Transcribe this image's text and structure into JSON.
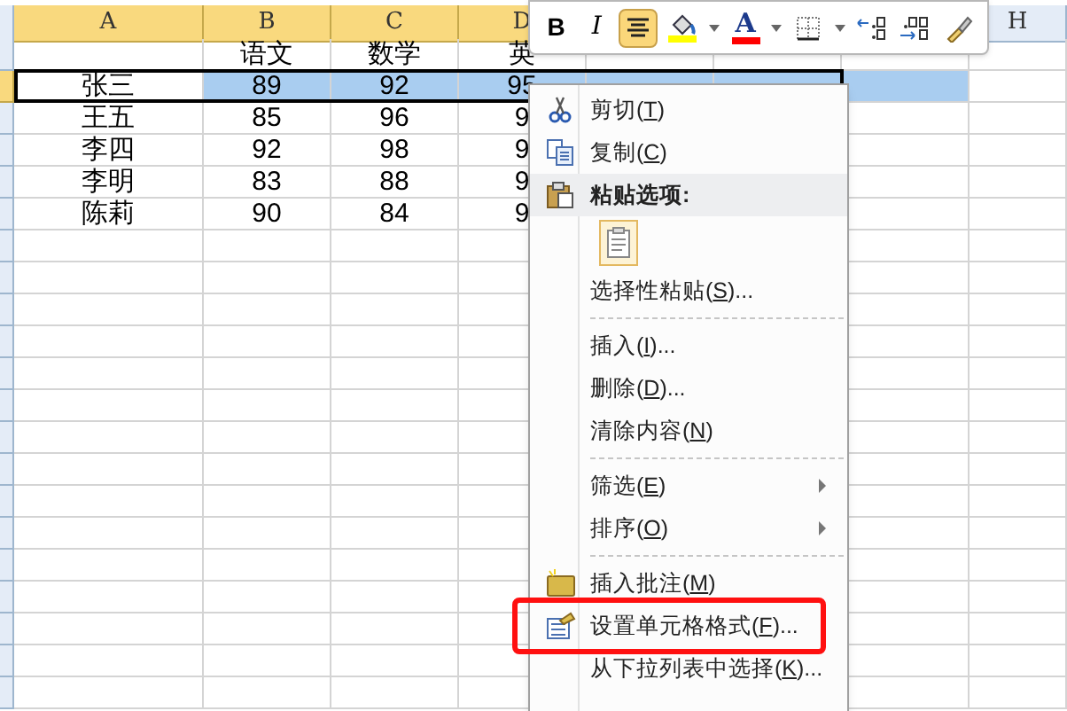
{
  "columns": [
    {
      "label": "A",
      "selected": true
    },
    {
      "label": "B",
      "selected": true
    },
    {
      "label": "C",
      "selected": true
    },
    {
      "label": "D",
      "selected": true
    },
    {
      "label": "H",
      "selected": false
    }
  ],
  "rows": [
    {
      "cells": [
        "",
        "语文",
        "数学",
        "英"
      ],
      "selected": false
    },
    {
      "cells": [
        "张三",
        "89",
        "92",
        "95"
      ],
      "selected": true
    },
    {
      "cells": [
        "王五",
        "85",
        "96",
        "9"
      ],
      "selected": false
    },
    {
      "cells": [
        "李四",
        "92",
        "98",
        "9"
      ],
      "selected": false
    },
    {
      "cells": [
        "李明",
        "83",
        "88",
        "9"
      ],
      "selected": false
    },
    {
      "cells": [
        "陈莉",
        "90",
        "84",
        "9"
      ],
      "selected": false
    }
  ],
  "mini_toolbar": [
    {
      "kind": "text",
      "label": "B",
      "selected": false
    },
    {
      "kind": "text",
      "label": "I",
      "selected": false
    },
    {
      "kind": "align",
      "selected": true
    },
    {
      "kind": "fill",
      "color": "#ffff00",
      "selected": false
    },
    {
      "kind": "dropdown"
    },
    {
      "kind": "fontcolor",
      "label": "A",
      "color": "#ff0000",
      "selected": false
    },
    {
      "kind": "dropdown"
    },
    {
      "kind": "border",
      "selected": false
    },
    {
      "kind": "dropdown"
    },
    {
      "kind": "incdec",
      "selected": false
    },
    {
      "kind": "decdec",
      "selected": false
    },
    {
      "kind": "painter",
      "selected": false
    }
  ],
  "context_menu": [
    {
      "kind": "item",
      "label": "剪切(T)",
      "submenu": false,
      "highlighted": false
    },
    {
      "kind": "item",
      "label": "复制(C)",
      "submenu": false,
      "highlighted": false
    },
    {
      "kind": "header",
      "label": "粘贴选项:"
    },
    {
      "kind": "paste"
    },
    {
      "kind": "item",
      "label": "选择性粘贴(S)...",
      "submenu": false,
      "highlighted": false
    },
    {
      "kind": "separator"
    },
    {
      "kind": "item",
      "label": "插入(I)...",
      "submenu": false,
      "highlighted": false
    },
    {
      "kind": "item",
      "label": "删除(D)...",
      "submenu": false,
      "highlighted": false
    },
    {
      "kind": "item",
      "label": "清除内容(N)",
      "submenu": false,
      "highlighted": false
    },
    {
      "kind": "separator"
    },
    {
      "kind": "item",
      "label": "筛选(E)",
      "submenu": true,
      "highlighted": false
    },
    {
      "kind": "item",
      "label": "排序(O)",
      "submenu": true,
      "highlighted": false
    },
    {
      "kind": "separator"
    },
    {
      "kind": "item",
      "label": "插入批注(M)",
      "submenu": false,
      "highlighted": false
    },
    {
      "kind": "item",
      "label": "设置单元格格式(F)...",
      "submenu": false,
      "highlighted": true
    },
    {
      "kind": "item",
      "label": "从下拉列表中选择(K)...",
      "submenu": false,
      "highlighted": false
    }
  ]
}
